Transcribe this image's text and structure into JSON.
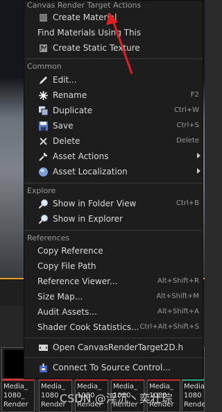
{
  "menu": {
    "sections": {
      "header": "Canvas Render Target Actions",
      "common": "Common",
      "explore": "Explore",
      "references": "References"
    },
    "items": {
      "create_material": {
        "label": "Create Material"
      },
      "find_materials": {
        "label": "Find Materials Using This"
      },
      "create_static_texture": {
        "label": "Create Static Texture"
      },
      "edit": {
        "label": "Edit..."
      },
      "rename": {
        "label": "Rename",
        "shortcut": "F2"
      },
      "duplicate": {
        "label": "Duplicate",
        "shortcut": "Ctrl+W"
      },
      "save": {
        "label": "Save",
        "shortcut": "Ctrl+S"
      },
      "delete": {
        "label": "Delete",
        "shortcut": "Delete"
      },
      "asset_actions": {
        "label": "Asset Actions"
      },
      "asset_localization": {
        "label": "Asset Localization"
      },
      "show_in_folder_view": {
        "label": "Show in Folder View",
        "shortcut": "Ctrl+B"
      },
      "show_in_explorer": {
        "label": "Show in Explorer"
      },
      "copy_reference": {
        "label": "Copy Reference"
      },
      "copy_file_path": {
        "label": "Copy File Path"
      },
      "reference_viewer": {
        "label": "Reference Viewer...",
        "shortcut": "Alt+Shift+R"
      },
      "size_map": {
        "label": "Size Map...",
        "shortcut": "Alt+Shift+M"
      },
      "audit_assets": {
        "label": "Audit Assets...",
        "shortcut": "Alt+Shift+A"
      },
      "shader_cook_statistics": {
        "label": "Shader Cook Statistics...",
        "shortcut": "Ctrl+Alt+Shift+S"
      },
      "open_header": {
        "label": "Open CanvasRenderTarget2D.h"
      },
      "connect_source_control": {
        "label": "Connect To Source Control..."
      }
    }
  },
  "assets": [
    {
      "line1": "Media_",
      "line2": "1080_",
      "line3": "Render"
    },
    {
      "line1": "Media_",
      "line2": "1080",
      "line3": "Render"
    },
    {
      "line1": "Media_",
      "line2": "1080",
      "line3": "Render"
    },
    {
      "line1": "Media_",
      "line2": "1080",
      "line3": "Render"
    },
    {
      "line1": "Media_",
      "line2": "1080",
      "line3": "Render"
    },
    {
      "line1": "Media_",
      "line2": "1080",
      "line3": "Render"
    }
  ],
  "watermark": "CSDN @浮沉丶奕壮琮",
  "colors": {
    "menu_bg": "#1d1d1d",
    "annotation_arrow": "#e02020",
    "asset_bar": "#cc3333"
  }
}
